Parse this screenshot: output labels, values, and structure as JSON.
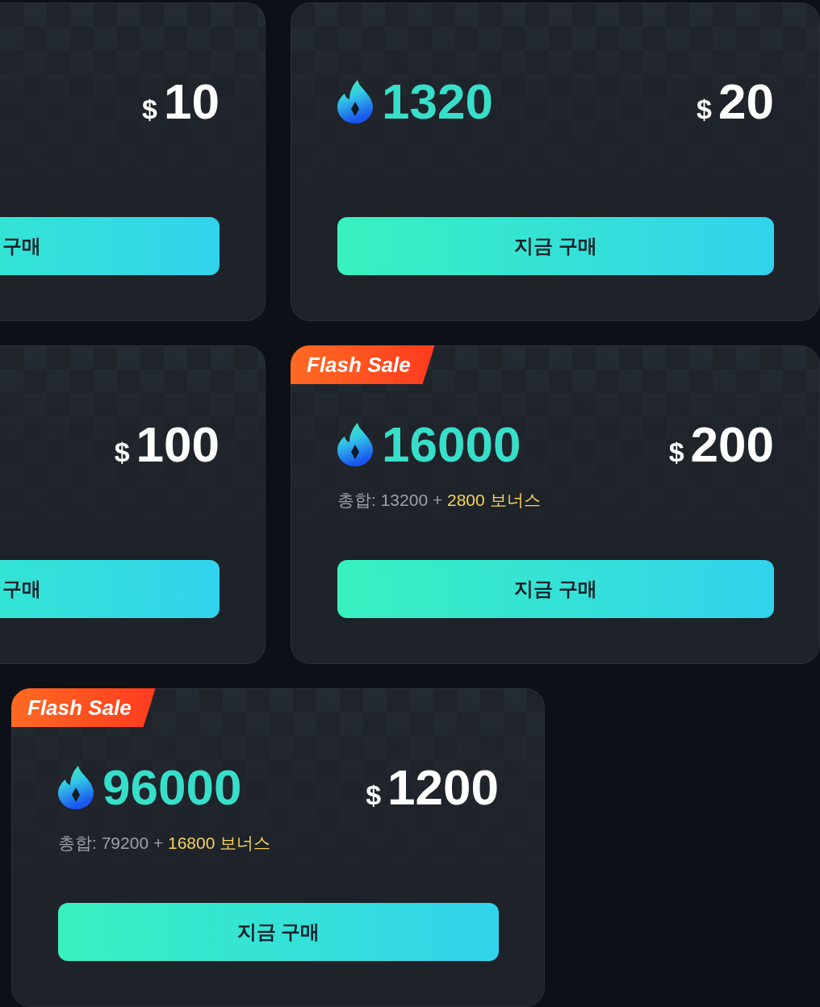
{
  "rows": [
    [
      {
        "kind": "cropped",
        "price_symbol": "$",
        "price": "10",
        "button": "구매"
      },
      {
        "kind": "full",
        "amount": "1320",
        "price_symbol": "$",
        "price": "20",
        "button": "지금 구매"
      }
    ],
    [
      {
        "kind": "cropped",
        "price_symbol": "$",
        "price": "100",
        "button": "구매"
      },
      {
        "kind": "full",
        "badge": "Flash Sale",
        "amount": "16000",
        "total_text": "총합: 13200 +",
        "bonus_text": "2800 보너스",
        "price_symbol": "$",
        "price": "200",
        "button": "지금 구매"
      }
    ],
    [
      {
        "kind": "full",
        "badge": "Flash Sale",
        "amount": "96000",
        "total_text": "총합: 79200 +",
        "bonus_text": "16800 보너스",
        "price_symbol": "$",
        "price": "1200",
        "button": "지금 구매"
      }
    ]
  ]
}
